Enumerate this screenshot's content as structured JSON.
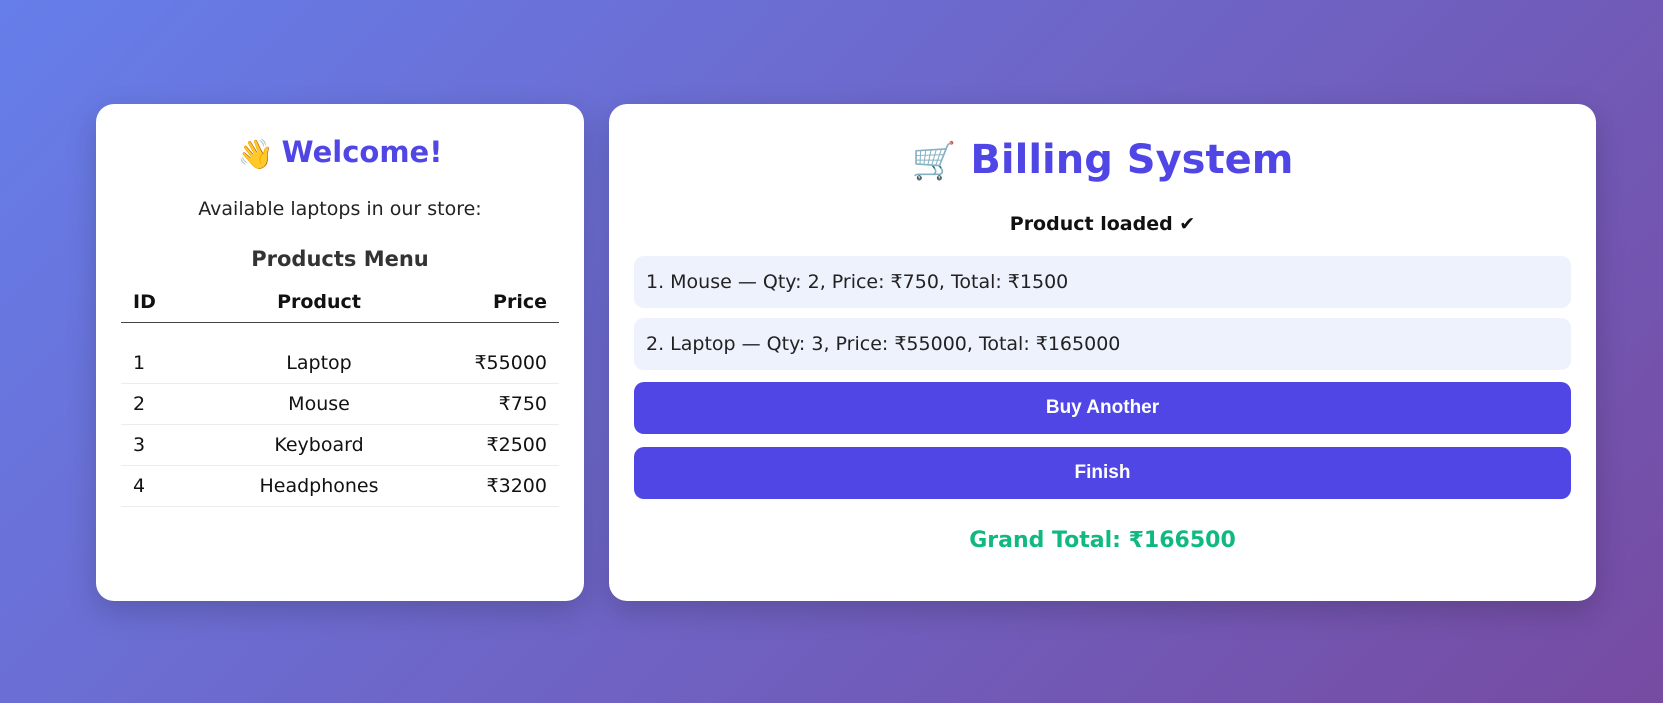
{
  "welcome": {
    "emoji": "👋",
    "title": "Welcome!",
    "subtitle": "Available laptops in our store:",
    "menu_title": "Products Menu",
    "table": {
      "headers": [
        "ID",
        "Product",
        "Price"
      ],
      "rows": [
        {
          "id": "1",
          "product": "Laptop",
          "price": "₹55000"
        },
        {
          "id": "2",
          "product": "Mouse",
          "price": "₹750"
        },
        {
          "id": "3",
          "product": "Keyboard",
          "price": "₹2500"
        },
        {
          "id": "4",
          "product": "Headphones",
          "price": "₹3200"
        }
      ]
    }
  },
  "billing": {
    "emoji": "🛒",
    "title": "Billing System",
    "status": "Product loaded ✔",
    "cart_items": [
      "1. Mouse — Qty: 2, Price: ₹750, Total: ₹1500",
      "2. Laptop — Qty: 3, Price: ₹55000, Total: ₹165000"
    ],
    "buy_another_label": "Buy Another",
    "finish_label": "Finish",
    "grand_total": "Grand Total: ₹166500"
  },
  "colors": {
    "accent": "#4f46e5",
    "total": "#10b981",
    "background_start": "#667eea",
    "background_end": "#764ba2",
    "cart_item_bg": "#eef2fd"
  },
  "icons": {
    "welcome": "waving-hand-icon",
    "billing": "shopping-cart-icon"
  }
}
